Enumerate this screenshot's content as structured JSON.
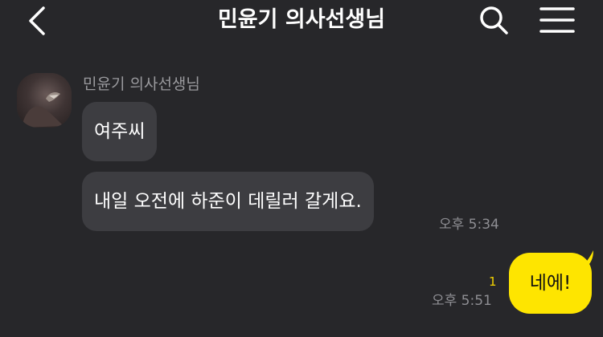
{
  "header": {
    "title": "민윤기 의사선생님",
    "back_icon": "chevron-left-icon",
    "search_icon": "search-icon",
    "menu_icon": "hamburger-menu-icon"
  },
  "conversation": {
    "sender_name": "민윤기 의사선생님",
    "received": [
      {
        "text": "여주씨"
      },
      {
        "text": "내일 오전에 하준이 데릴러 갈게요.",
        "time": "오후 5:34"
      }
    ],
    "sent": [
      {
        "text": "네에!",
        "time": "오후 5:51",
        "unread_count": "1"
      }
    ]
  },
  "colors": {
    "background": "#27272a",
    "received_bubble": "#3d3d41",
    "sent_bubble": "#fee500",
    "unread_count": "#f5d400"
  }
}
